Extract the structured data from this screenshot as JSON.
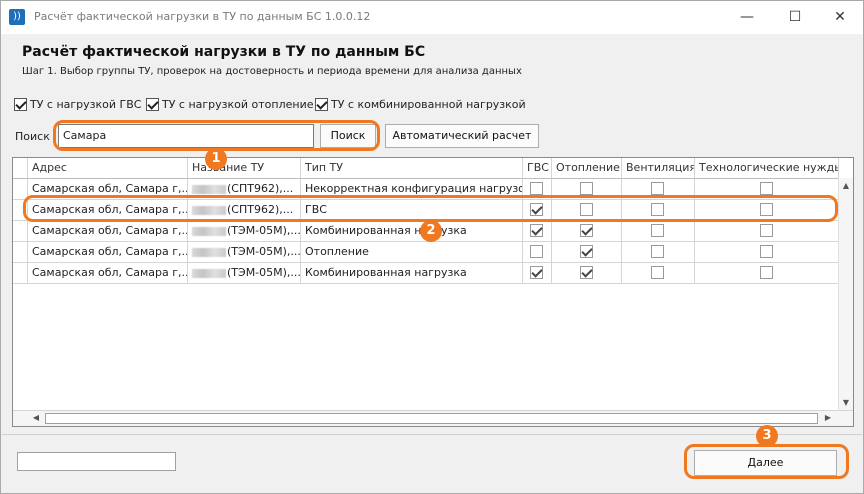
{
  "window": {
    "title": "Расчёт фактической нагрузки в ТУ по данным БС 1.0.0.12",
    "app_icon": "signal-icon",
    "minimize": "—",
    "maximize": "☐",
    "close": "✕"
  },
  "header": {
    "title": "Расчёт фактической нагрузки в ТУ по данным БС",
    "subtitle": "Шаг 1. Выбор группы ТУ, проверок на достоверность и периода времени для анализа данных"
  },
  "filters": [
    {
      "label": "ТУ с нагрузкой ГВС",
      "checked": true
    },
    {
      "label": "ТУ с нагрузкой отопление",
      "checked": true
    },
    {
      "label": "ТУ с комбинированной нагрузкой",
      "checked": true
    }
  ],
  "search": {
    "label": "Поиск",
    "value": "Самара",
    "button": "Поиск"
  },
  "auto_button": "Автоматический расчет",
  "grid": {
    "columns": [
      "Адрес",
      "Название ТУ",
      "Тип ТУ",
      "ГВС",
      "Отопление",
      "Вентиляция",
      "Технологические нужды"
    ],
    "rows": [
      {
        "address": "Самарская обл, Самара г,...",
        "name": "(СПТ962),...",
        "type": "Некорректная конфигурация нагрузок",
        "gvs": false,
        "heating": false,
        "vent": false,
        "tech": false
      },
      {
        "address": "Самарская обл, Самара г,...",
        "name": "(СПТ962),...",
        "type": "ГВС",
        "gvs": true,
        "heating": false,
        "vent": false,
        "tech": false
      },
      {
        "address": "Самарская обл, Самара г,...",
        "name": "(ТЭМ-05М),...",
        "type": "Комбинированная нагрузка",
        "gvs": true,
        "heating": true,
        "vent": false,
        "tech": false
      },
      {
        "address": "Самарская обл, Самара г,...",
        "name": "(ТЭМ-05М),...",
        "type": "Отопление",
        "gvs": false,
        "heating": true,
        "vent": false,
        "tech": false
      },
      {
        "address": "Самарская обл, Самара г,...",
        "name": "(ТЭМ-05М),...",
        "type": "Комбинированная нагрузка",
        "gvs": true,
        "heating": true,
        "vent": false,
        "tech": false
      }
    ]
  },
  "annotations": {
    "badge1": "1",
    "badge2": "2",
    "badge3": "3",
    "color": "#f07820"
  },
  "footer": {
    "next_button": "Далее"
  }
}
